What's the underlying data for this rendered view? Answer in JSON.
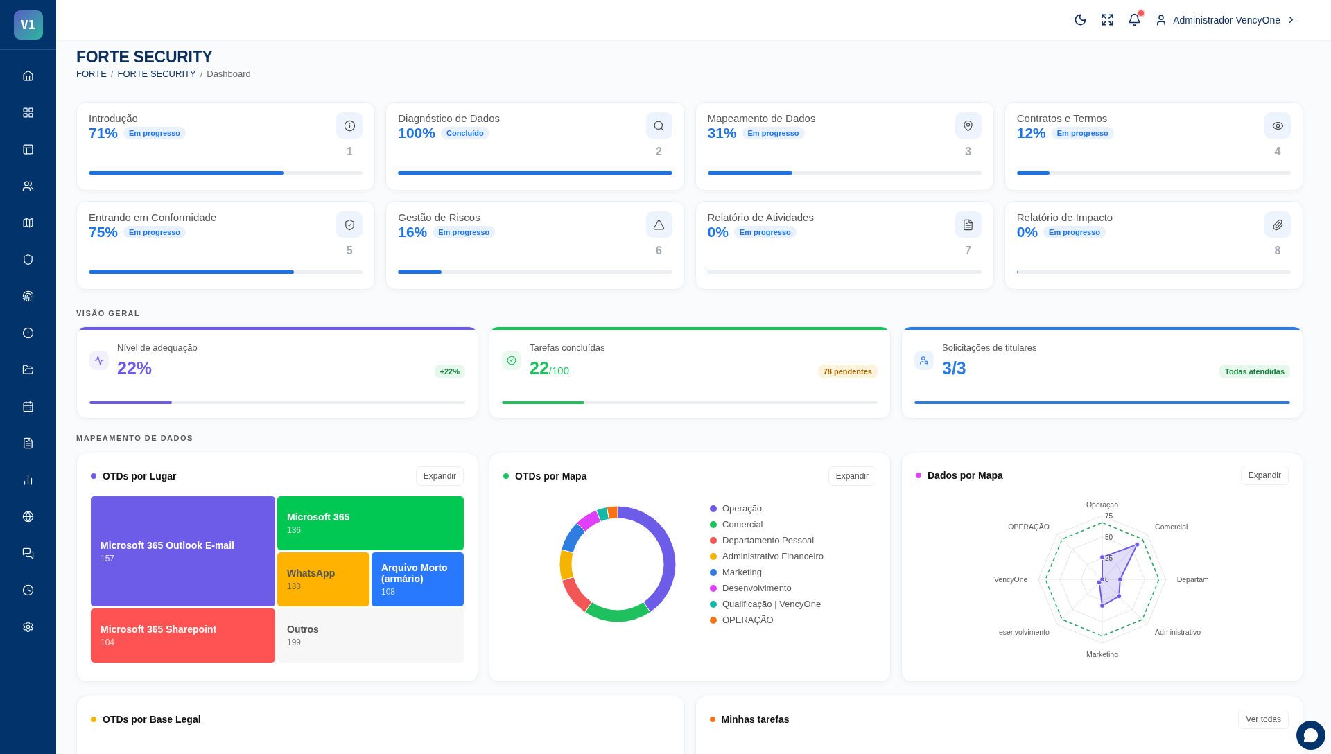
{
  "sidebar": {
    "logo": "V1"
  },
  "header": {
    "has_notifications": true,
    "user": "Administrador VencyOne"
  },
  "page": {
    "title": "FORTE SECURITY",
    "breadcrumb_separator": "/",
    "breadcrumb": [
      "FORTE",
      "FORTE SECURITY",
      "Dashboard"
    ]
  },
  "modules": [
    {
      "title": "Introdução",
      "percent": "71%",
      "status": "Em progresso",
      "number": "1",
      "level": 0.71
    },
    {
      "title": "Diagnóstico de Dados",
      "percent": "100%",
      "status": "Concluído",
      "number": "2",
      "level": 1
    },
    {
      "title": "Mapeamento de Dados",
      "percent": "31%",
      "status": "Em progresso",
      "number": "3",
      "level": 0.31
    },
    {
      "title": "Contratos e Termos",
      "percent": "12%",
      "status": "Em progresso",
      "number": "4",
      "level": 0.12
    },
    {
      "title": "Entrando em Conformidade",
      "percent": "75%",
      "status": "Em progresso",
      "number": "5",
      "level": 0.75
    },
    {
      "title": "Gestão de Riscos",
      "percent": "16%",
      "status": "Em progresso",
      "number": "6",
      "level": 0.16
    },
    {
      "title": "Relatório de Atividades",
      "percent": "0%",
      "status": "Em progresso",
      "number": "7",
      "level": 0
    },
    {
      "title": "Relatório de Impacto",
      "percent": "0%",
      "status": "Em progresso",
      "number": "8",
      "level": 0
    }
  ],
  "overview": {
    "title": "VISÃO GERAL",
    "cards": [
      {
        "label": "Nível de adequação",
        "value": "22%",
        "badge": {
          "text": "+22%",
          "kind": "success"
        },
        "color": "#6c5ce7",
        "level": 0.22
      },
      {
        "label": "Tarefas concluídas",
        "value": "22",
        "suffix": "/100",
        "badge": {
          "text": "78 pendentes",
          "kind": "warning"
        },
        "color": "#1fc15f",
        "level": 0.22
      },
      {
        "label": "Solicitações de titulares",
        "value": "3/3",
        "badge": {
          "text": "Todas atendidas",
          "kind": "success"
        },
        "color": "#2f7de1",
        "level": 1
      }
    ]
  },
  "mapping": {
    "title": "MAPEAMENTO DE DADOS",
    "panels": [
      {
        "kind": "treemap",
        "title": "OTDs por Lugar",
        "color": "#6c5ce7",
        "action": "Expandir",
        "items": [
          {
            "label": "Microsoft 365 Outlook E-mail",
            "value": "157",
            "color": "#6c5ce7"
          },
          {
            "label": "Microsoft 365",
            "value": "136",
            "color": "#00c853"
          },
          {
            "label": "WhatsApp",
            "value": "133",
            "color": "#ffb300"
          },
          {
            "label": "Arquivo Morto (armário)",
            "value": "108",
            "color": "#2979ff"
          },
          {
            "label": "Microsoft 365 Sharepoint",
            "value": "104",
            "color": "#ff5252"
          },
          {
            "label": "Outros",
            "value": "199",
            "color": "#f7f7f8"
          }
        ]
      },
      {
        "kind": "donut",
        "title": "OTDs por Mapa",
        "color": "#1fc15f",
        "action": "Expandir",
        "legend": [
          {
            "label": "Operação",
            "color": "#6c5ce7"
          },
          {
            "label": "Comercial",
            "color": "#1fc15f"
          },
          {
            "label": "Departamento Pessoal",
            "color": "#f25757"
          },
          {
            "label": "Administrativo Financeiro",
            "color": "#f5b400"
          },
          {
            "label": "Marketing",
            "color": "#2f7de1"
          },
          {
            "label": "Desenvolvimento",
            "color": "#e040fb"
          },
          {
            "label": "Qualificação | VencyOne",
            "color": "#14b8a6"
          },
          {
            "label": "OPERAÇÃO",
            "color": "#f97316"
          }
        ]
      },
      {
        "kind": "radar",
        "title": "Dados por Mapa",
        "color": "#d946ef",
        "action": "Expandir",
        "chart_data": {
          "type": "radar",
          "categories": [
            "Operação",
            "Comercial",
            "Departam",
            "Administrativo",
            "Marketing",
            "esenvolvimento",
            "VencyOne",
            "OPERAÇÃO"
          ],
          "ylim": [
            0,
            75
          ],
          "yticks": [
            0,
            25,
            50,
            75
          ],
          "series": [
            {
              "color": "#6c5ce7",
              "values": [
                26,
                58,
                21,
                28,
                31,
                5,
                0,
                0
              ]
            }
          ]
        }
      }
    ]
  },
  "bottom": [
    {
      "title": "OTDs por Base Legal",
      "color": "#f5b400"
    },
    {
      "title": "Minhas tarefas",
      "color": "#f97316",
      "action": "Ver todas"
    }
  ]
}
